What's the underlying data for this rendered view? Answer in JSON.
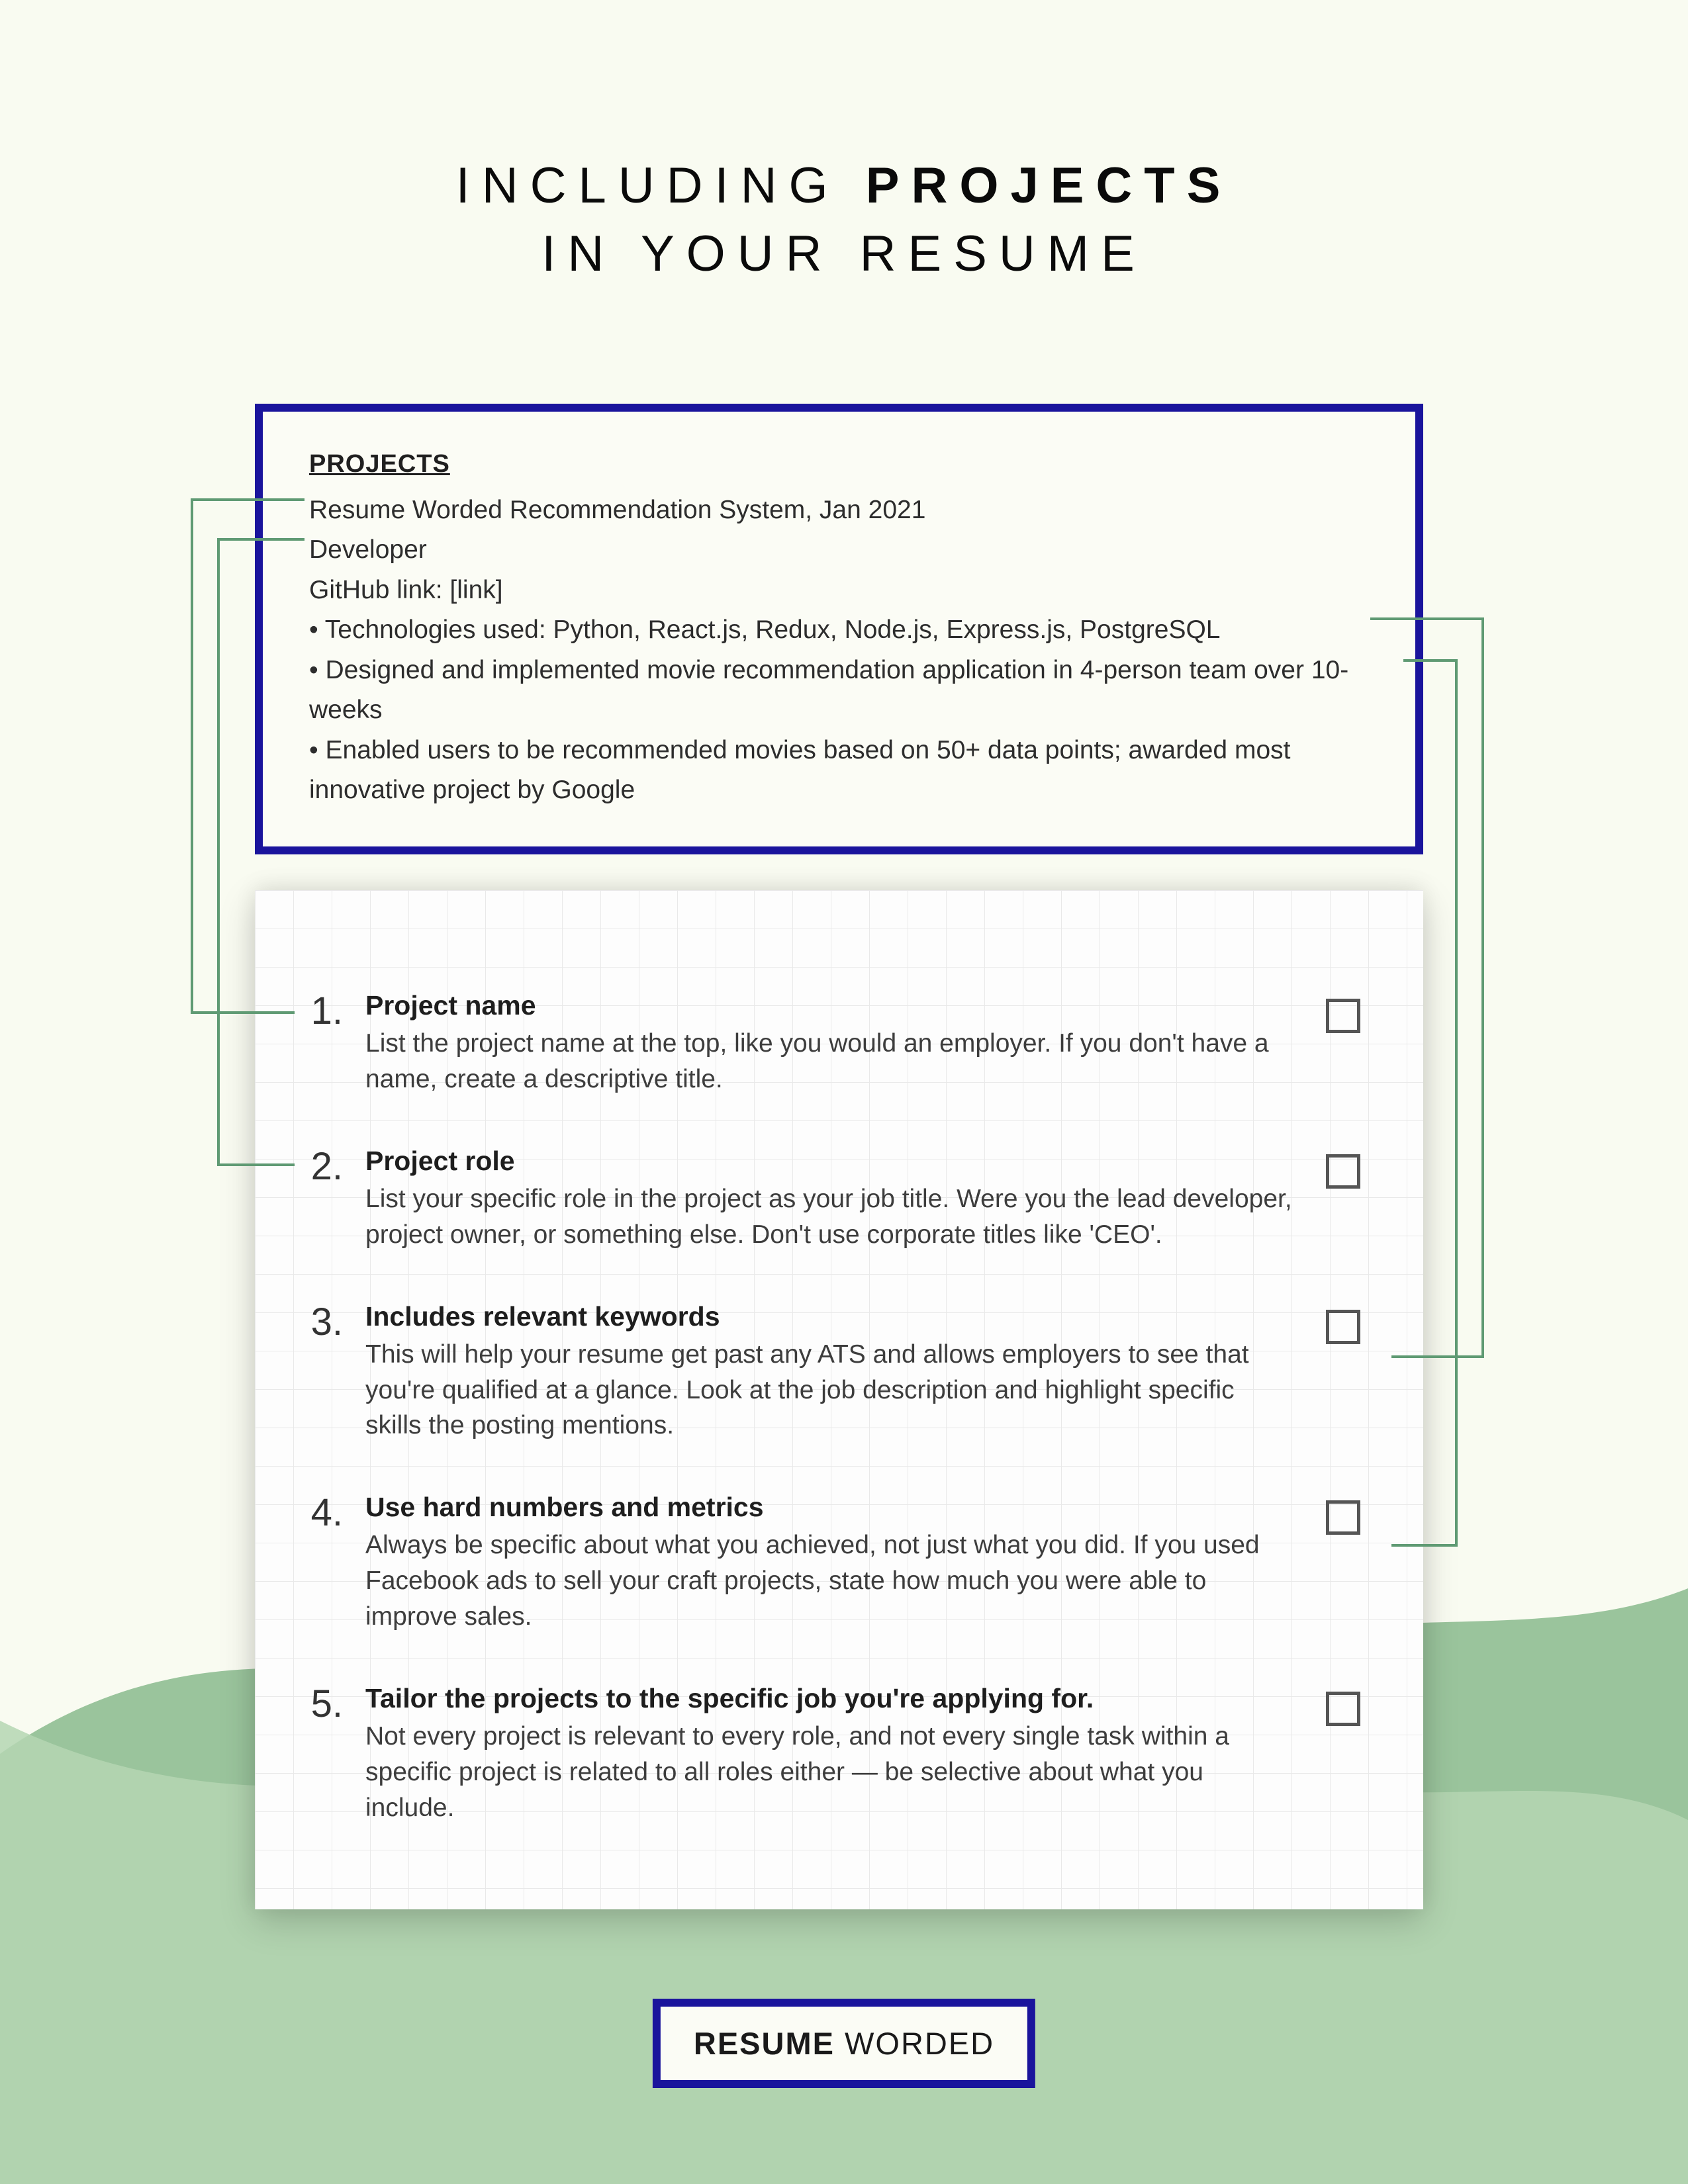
{
  "title": {
    "prefix": "INCLUDING ",
    "bold": "PROJECTS",
    "line2": "IN YOUR RESUME"
  },
  "example": {
    "heading": "PROJECTS",
    "line1": "Resume Worded Recommendation System, Jan 2021",
    "line2": "Developer",
    "line3": "GitHub link: [link]",
    "bullets": [
      "Technologies used: Python, React.js, Redux, Node.js, Express.js, PostgreSQL",
      "Designed and implemented movie recommendation application in 4-person team over 10-weeks",
      "Enabled users to be recommended movies based on 50+ data points; awarded most innovative project by Google"
    ]
  },
  "checklist": [
    {
      "num": "1.",
      "title": "Project name",
      "desc": "List the project name at the top, like you would an employer. If you don't have a name, create a descriptive title."
    },
    {
      "num": "2.",
      "title": "Project role",
      "desc": "List your specific role in the project as your job title. Were you the lead developer, project owner, or something else. Don't use corporate titles like 'CEO'."
    },
    {
      "num": "3.",
      "title": "Includes relevant keywords",
      "desc": "This will help your resume get past any ATS and allows employers to see that you're qualified at a glance. Look at the job description and highlight specific skills the posting mentions."
    },
    {
      "num": "4.",
      "title": "Use hard numbers and metrics",
      "desc": "Always be specific about what you achieved, not just what you did. If you used Facebook ads to sell your craft projects, state how much you were able to improve sales."
    },
    {
      "num": "5.",
      "title": "Tailor the projects to the specific job you're applying for.",
      "desc": "Not every project is relevant to every role, and not every single task within a specific project is related to all roles either — be selective about what you include."
    }
  ],
  "logo": {
    "bold": "RESUME",
    "rest": " WORDED"
  }
}
